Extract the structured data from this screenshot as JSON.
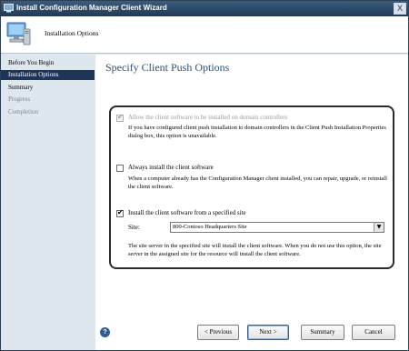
{
  "window": {
    "title": "Install Configuration Manager Client Wizard",
    "close_label": "X"
  },
  "header": {
    "text": "Installation Options"
  },
  "sidebar": {
    "items": [
      {
        "label": "Before You Begin"
      },
      {
        "label": "Installation Options"
      },
      {
        "label": "Summary"
      },
      {
        "label": "Progress"
      },
      {
        "label": "Completion"
      }
    ]
  },
  "page": {
    "title": "Specify Client Push Options"
  },
  "options": {
    "domain_controllers": {
      "label": "Allow the client software to be installed on domain controllers",
      "checked": true,
      "enabled": false,
      "description": "If you have configured client push installation to domain controllers in the Client Push Installation Properties dialog box, this option is unavailable."
    },
    "always_install": {
      "label": "Always install the client software",
      "checked": false,
      "enabled": true,
      "description": "When a computer already has the Configuration Manager client installed, you can repair, upgrade, or reinstall the client software."
    },
    "specified_site": {
      "label": "Install the client software from a specified site",
      "checked": true,
      "enabled": true,
      "site_label": "Site:",
      "site_value": "800-Contoso Headquarters Site",
      "description": "The site server in the specified site will install the client software.  When you do not use this option, the site server in the assigned site for the resource will install the client software."
    }
  },
  "buttons": {
    "help": "?",
    "previous": "< Previous",
    "next": "Next >",
    "summary": "Summary",
    "cancel": "Cancel"
  },
  "colors": {
    "title_bar": "#1e3a57",
    "selected_nav": "#1d3557",
    "page_title": "#2f5178",
    "sidebar_bg": "#dfe7ee"
  }
}
